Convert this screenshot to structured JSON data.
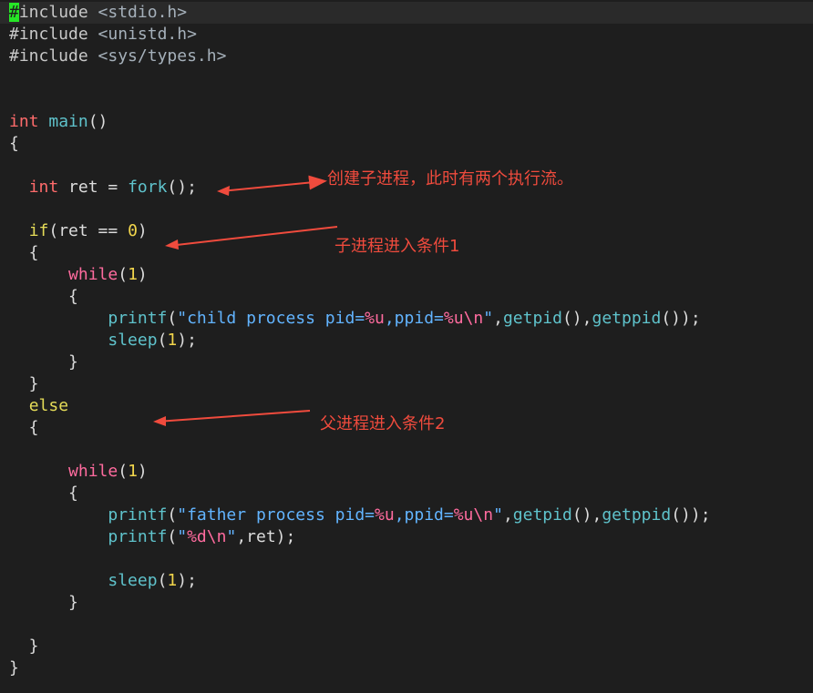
{
  "code_lines": [
    [
      {
        "t": "#",
        "c": "cursor"
      },
      {
        "t": "include ",
        "c": "tok-pre"
      },
      {
        "t": "<stdio.h>",
        "c": "tok-inc"
      }
    ],
    [
      {
        "t": "#include ",
        "c": "tok-pre"
      },
      {
        "t": "<unistd.h>",
        "c": "tok-inc"
      }
    ],
    [
      {
        "t": "#include ",
        "c": "tok-pre"
      },
      {
        "t": "<sys/types.h>",
        "c": "tok-inc"
      }
    ],
    [],
    [],
    [
      {
        "t": "int",
        "c": "tok-type"
      },
      {
        "t": " ",
        "c": "tok-plain"
      },
      {
        "t": "main",
        "c": "tok-fn"
      },
      {
        "t": "()",
        "c": "tok-plain"
      }
    ],
    [
      {
        "t": "{",
        "c": "tok-plain"
      }
    ],
    [],
    [
      {
        "t": "  ",
        "c": "tok-plain"
      },
      {
        "t": "int",
        "c": "tok-type"
      },
      {
        "t": " ret = ",
        "c": "tok-plain"
      },
      {
        "t": "fork",
        "c": "tok-fn"
      },
      {
        "t": "();",
        "c": "tok-plain"
      }
    ],
    [],
    [
      {
        "t": "  ",
        "c": "tok-plain"
      },
      {
        "t": "if",
        "c": "tok-kw"
      },
      {
        "t": "(ret == ",
        "c": "tok-plain"
      },
      {
        "t": "0",
        "c": "tok-num"
      },
      {
        "t": ")",
        "c": "tok-plain"
      }
    ],
    [
      {
        "t": "  {",
        "c": "tok-plain"
      }
    ],
    [
      {
        "t": "      ",
        "c": "tok-plain"
      },
      {
        "t": "while",
        "c": "tok-loop"
      },
      {
        "t": "(",
        "c": "tok-plain"
      },
      {
        "t": "1",
        "c": "tok-num"
      },
      {
        "t": ")",
        "c": "tok-plain"
      }
    ],
    [
      {
        "t": "      {",
        "c": "tok-plain"
      }
    ],
    [
      {
        "t": "          ",
        "c": "tok-plain"
      },
      {
        "t": "printf",
        "c": "tok-fn"
      },
      {
        "t": "(",
        "c": "tok-plain"
      },
      {
        "t": "\"child process pid=",
        "c": "tok-str"
      },
      {
        "t": "%u",
        "c": "tok-esc"
      },
      {
        "t": ",ppid=",
        "c": "tok-str"
      },
      {
        "t": "%u",
        "c": "tok-esc"
      },
      {
        "t": "\\n",
        "c": "tok-esc"
      },
      {
        "t": "\"",
        "c": "tok-str"
      },
      {
        "t": ",",
        "c": "tok-plain"
      },
      {
        "t": "getpid",
        "c": "tok-fn"
      },
      {
        "t": "(),",
        "c": "tok-plain"
      },
      {
        "t": "getppid",
        "c": "tok-fn"
      },
      {
        "t": "());",
        "c": "tok-plain"
      }
    ],
    [
      {
        "t": "          ",
        "c": "tok-plain"
      },
      {
        "t": "sleep",
        "c": "tok-fn"
      },
      {
        "t": "(",
        "c": "tok-plain"
      },
      {
        "t": "1",
        "c": "tok-num"
      },
      {
        "t": ");",
        "c": "tok-plain"
      }
    ],
    [
      {
        "t": "      }",
        "c": "tok-plain"
      }
    ],
    [
      {
        "t": "  }",
        "c": "tok-plain"
      }
    ],
    [
      {
        "t": "  ",
        "c": "tok-plain"
      },
      {
        "t": "else",
        "c": "tok-kw"
      }
    ],
    [
      {
        "t": "  {",
        "c": "tok-plain"
      }
    ],
    [],
    [
      {
        "t": "      ",
        "c": "tok-plain"
      },
      {
        "t": "while",
        "c": "tok-loop"
      },
      {
        "t": "(",
        "c": "tok-plain"
      },
      {
        "t": "1",
        "c": "tok-num"
      },
      {
        "t": ")",
        "c": "tok-plain"
      }
    ],
    [
      {
        "t": "      {",
        "c": "tok-plain"
      }
    ],
    [
      {
        "t": "          ",
        "c": "tok-plain"
      },
      {
        "t": "printf",
        "c": "tok-fn"
      },
      {
        "t": "(",
        "c": "tok-plain"
      },
      {
        "t": "\"father process pid=",
        "c": "tok-str"
      },
      {
        "t": "%u",
        "c": "tok-esc"
      },
      {
        "t": ",ppid=",
        "c": "tok-str"
      },
      {
        "t": "%u",
        "c": "tok-esc"
      },
      {
        "t": "\\n",
        "c": "tok-esc"
      },
      {
        "t": "\"",
        "c": "tok-str"
      },
      {
        "t": ",",
        "c": "tok-plain"
      },
      {
        "t": "getpid",
        "c": "tok-fn"
      },
      {
        "t": "(),",
        "c": "tok-plain"
      },
      {
        "t": "getppid",
        "c": "tok-fn"
      },
      {
        "t": "());",
        "c": "tok-plain"
      }
    ],
    [
      {
        "t": "          ",
        "c": "tok-plain"
      },
      {
        "t": "printf",
        "c": "tok-fn"
      },
      {
        "t": "(",
        "c": "tok-plain"
      },
      {
        "t": "\"",
        "c": "tok-str"
      },
      {
        "t": "%d",
        "c": "tok-esc"
      },
      {
        "t": "\\n",
        "c": "tok-esc"
      },
      {
        "t": "\"",
        "c": "tok-str"
      },
      {
        "t": ",ret);",
        "c": "tok-plain"
      }
    ],
    [],
    [
      {
        "t": "          ",
        "c": "tok-plain"
      },
      {
        "t": "sleep",
        "c": "tok-fn"
      },
      {
        "t": "(",
        "c": "tok-plain"
      },
      {
        "t": "1",
        "c": "tok-num"
      },
      {
        "t": ");",
        "c": "tok-plain"
      }
    ],
    [
      {
        "t": "      }",
        "c": "tok-plain"
      }
    ],
    [],
    [
      {
        "t": "  }",
        "c": "tok-plain"
      }
    ],
    [
      {
        "t": "}",
        "c": "tok-plain"
      }
    ]
  ],
  "annotations": {
    "fork_note": "创建子进程，此时有两个执行流。",
    "child_note": "子进程进入条件1",
    "parent_note": "父进程进入条件2"
  },
  "colors": {
    "background": "#1e1e1e",
    "annotation": "#f04b3d",
    "cursor": "#26e626"
  }
}
